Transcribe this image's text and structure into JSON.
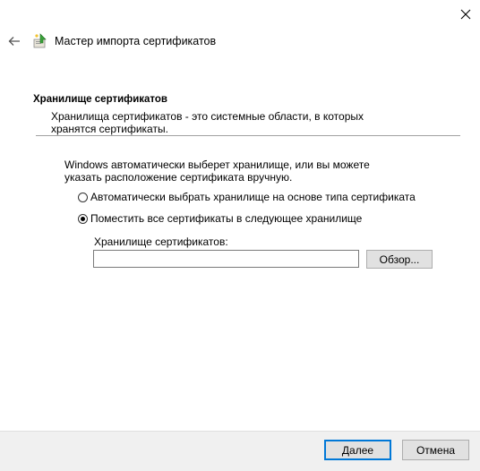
{
  "window": {
    "title": "Мастер импорта сертификатов"
  },
  "icons": {
    "close": "close-icon",
    "back": "back-arrow-icon",
    "wizard": "certificate-wizard-icon"
  },
  "page": {
    "section_title": "Хранилище сертификатов",
    "section_description": "Хранилища сертификатов - это системные области, в которых хранятся сертификаты.",
    "intro_text": "Windows автоматически выберет хранилище, или вы можете указать расположение сертификата вручную.",
    "options": [
      {
        "label": "Автоматически выбрать хранилище на основе типа сертификата",
        "selected": false
      },
      {
        "label": "Поместить все сертификаты в следующее хранилище",
        "selected": true
      }
    ],
    "store_label": "Хранилище сертификатов:",
    "store_value": "",
    "browse_label": "Обзор..."
  },
  "footer": {
    "next_label": "Далее",
    "cancel_label": "Отмена"
  },
  "colors": {
    "accent": "#0078d7",
    "footer_bg": "#f0f0f0",
    "button_bg": "#e1e1e1"
  }
}
